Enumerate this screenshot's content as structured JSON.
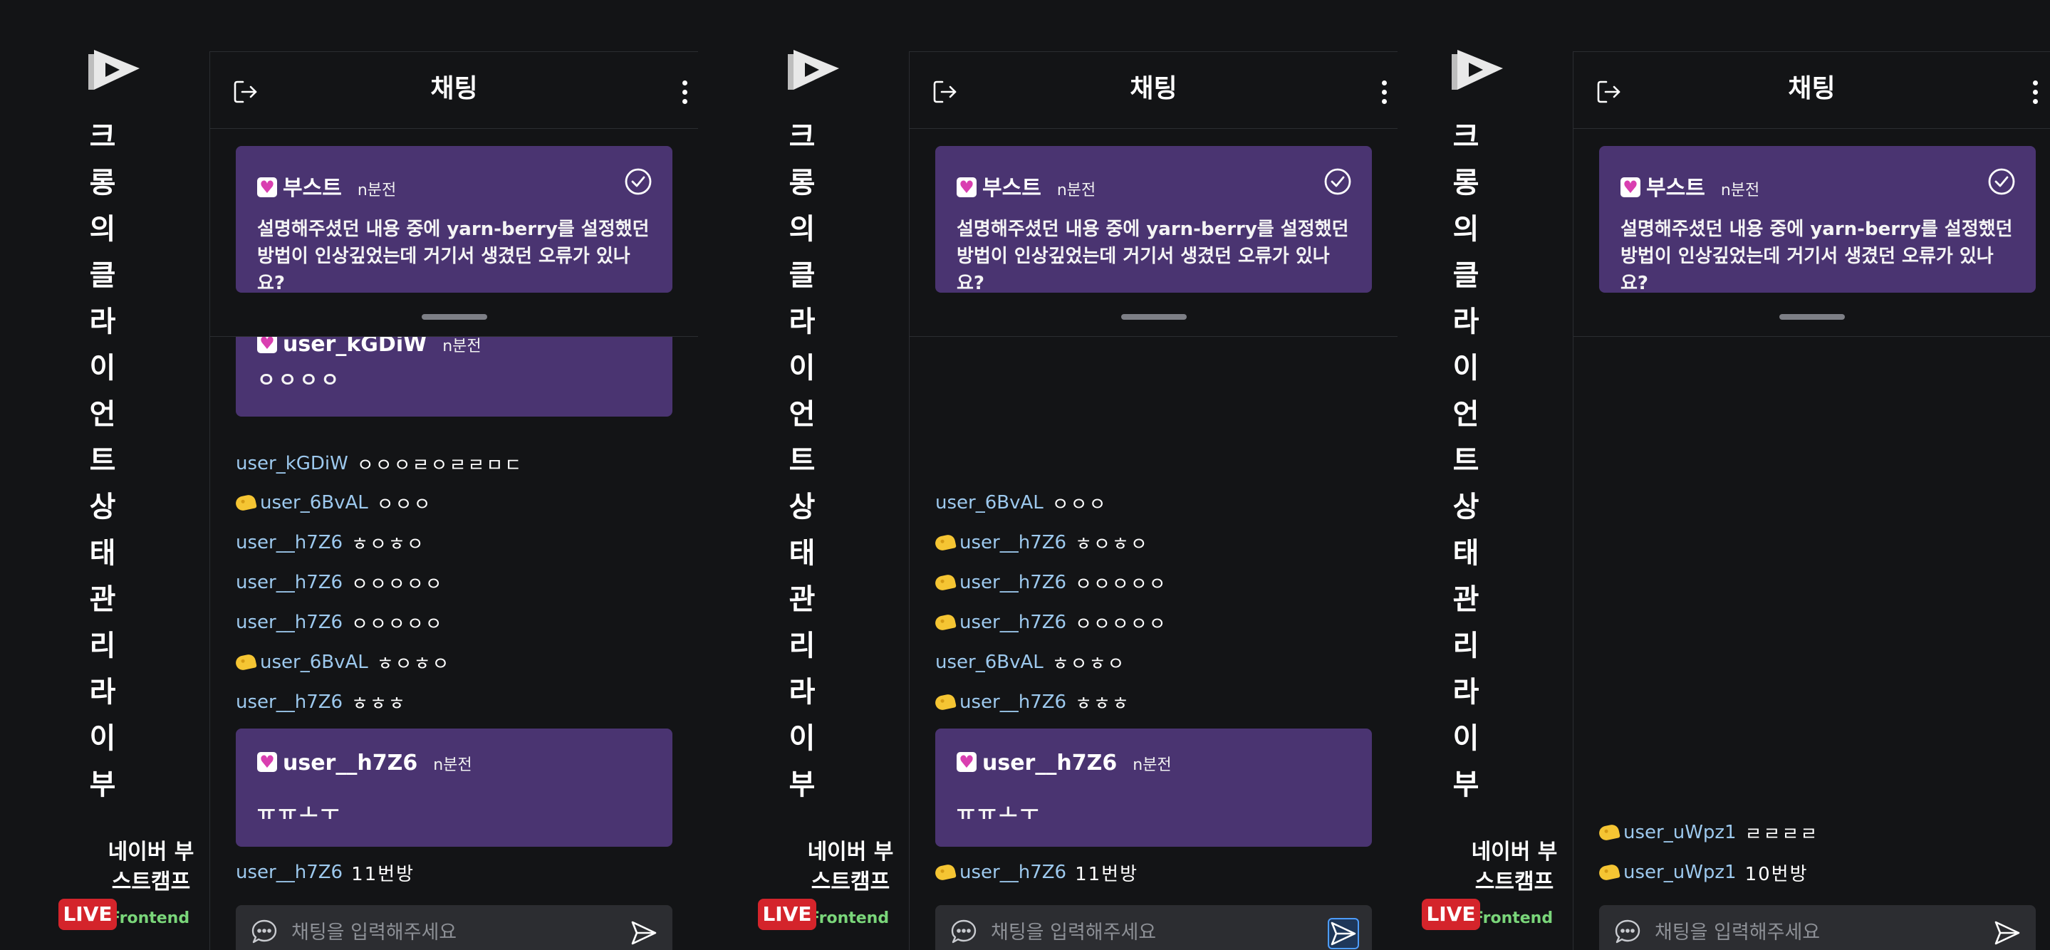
{
  "screens": [
    {
      "sidebar": {
        "title_chars": [
          "크",
          "롱",
          "의",
          "클",
          "라",
          "이",
          "언",
          "트",
          "상",
          "태",
          "관",
          "리",
          "라",
          "이",
          "부"
        ],
        "host_name": "네이버 부스트캠프",
        "category": "Frontend",
        "live_label": "LIVE"
      },
      "chat": {
        "title": "채팅",
        "pinned": {
          "name": "부스트",
          "time": "n분전",
          "message": "설명해주셨던 내용 중에 yarn-berry를 설정했던 방법이 인상깊었는데 거기서 생겼던 오류가 있나요?"
        },
        "highlight_top": {
          "name": "user_kGDiW",
          "time": "n분전",
          "message": "ㅇㅇㅇㅇ"
        },
        "messages": [
          {
            "user": "user_kGDiW",
            "text": "ㅇㅇㅇㄹㅇㄹㄹㅁㄷ",
            "badge": ""
          },
          {
            "user": "user_6BvAL",
            "text": "ㅇㅇㅇ",
            "badge": "cheese-icon"
          },
          {
            "user": "user__h7Z6",
            "text": "ㅎㅇㅎㅇ",
            "badge": ""
          },
          {
            "user": "user__h7Z6",
            "text": "ㅇㅇㅇㅇㅇ",
            "badge": ""
          },
          {
            "user": "user__h7Z6",
            "text": "ㅇㅇㅇㅇㅇ",
            "badge": ""
          },
          {
            "user": "user_6BvAL",
            "text": "ㅎㅇㅎㅇ",
            "badge": "cheese-icon"
          },
          {
            "user": "user__h7Z6",
            "text": "ㅎㅎㅎ",
            "badge": ""
          }
        ],
        "highlight_bottom": {
          "name": "user__h7Z6",
          "time": "n분전",
          "message": "ㅠㅠㅗㅜ"
        },
        "last_message": {
          "user": "user__h7Z6",
          "text": "11번방",
          "badge": ""
        },
        "input_placeholder": "채팅을 입력해주세요"
      }
    },
    {
      "sidebar": {
        "title_chars": [
          "크",
          "롱",
          "의",
          "클",
          "라",
          "이",
          "언",
          "트",
          "상",
          "태",
          "관",
          "리",
          "라",
          "이",
          "부"
        ],
        "host_name": "네이버 부스트캠프",
        "category": "Frontend",
        "live_label": "LIVE"
      },
      "chat": {
        "title": "채팅",
        "pinned": {
          "name": "부스트",
          "time": "n분전",
          "message": "설명해주셨던 내용 중에 yarn-berry를 설정했던 방법이 인상깊었는데 거기서 생겼던 오류가 있나요?"
        },
        "messages": [
          {
            "user": "user_6BvAL",
            "text": "ㅇㅇㅇ",
            "badge": ""
          },
          {
            "user": "user__h7Z6",
            "text": "ㅎㅇㅎㅇ",
            "badge": "cheese-icon"
          },
          {
            "user": "user__h7Z6",
            "text": "ㅇㅇㅇㅇㅇ",
            "badge": "cheese-icon"
          },
          {
            "user": "user__h7Z6",
            "text": "ㅇㅇㅇㅇㅇ",
            "badge": "cheese-icon"
          },
          {
            "user": "user_6BvAL",
            "text": "ㅎㅇㅎㅇ",
            "badge": ""
          },
          {
            "user": "user__h7Z6",
            "text": "ㅎㅎㅎ",
            "badge": "cheese-icon"
          }
        ],
        "highlight_bottom": {
          "name": "user__h7Z6",
          "time": "n분전",
          "message": "ㅠㅠㅗㅜ"
        },
        "last_message": {
          "user": "user__h7Z6",
          "text": "11번방",
          "badge": "cheese-icon"
        },
        "input_placeholder": "채팅을 입력해주세요"
      }
    },
    {
      "sidebar": {
        "title_chars": [
          "크",
          "롱",
          "의",
          "클",
          "라",
          "이",
          "언",
          "트",
          "상",
          "태",
          "관",
          "리",
          "라",
          "이",
          "부"
        ],
        "host_name": "네이버 부스트캠프",
        "category": "Frontend",
        "live_label": "LIVE"
      },
      "chat": {
        "title": "채팅",
        "pinned": {
          "name": "부스트",
          "time": "n분전",
          "message": "설명해주셨던 내용 중에 yarn-berry를 설정했던 방법이 인상깊었는데 거기서 생겼던 오류가 있나요?"
        },
        "messages": [
          {
            "user": "user_uWpz1",
            "text": "ㄹㄹㄹㄹ",
            "badge": "cheese-icon"
          }
        ],
        "last_message": {
          "user": "user_uWpz1",
          "text": "10번방",
          "badge": "cheese-icon"
        },
        "input_placeholder": "채팅을 입력해주세요"
      }
    }
  ]
}
